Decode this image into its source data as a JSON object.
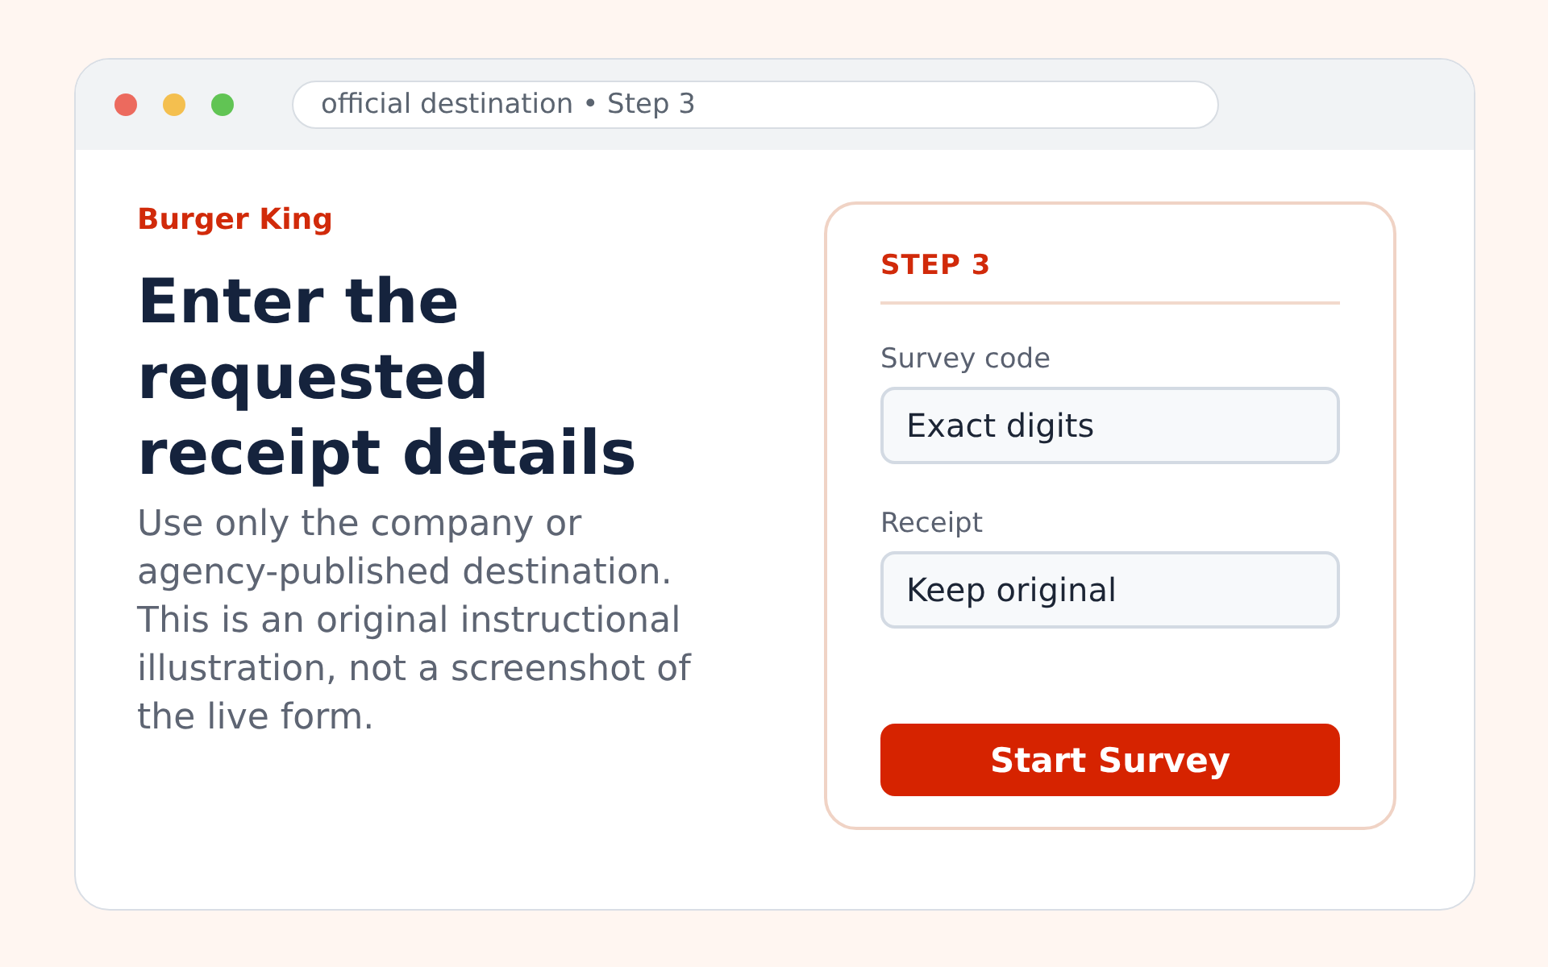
{
  "window": {
    "controls": [
      {
        "color": "#ec6a5e"
      },
      {
        "color": "#f4bf4f"
      },
      {
        "color": "#61c454"
      }
    ],
    "address": "official destination • Step 3"
  },
  "intro": {
    "brand": "Burger King",
    "heading": "Enter the requested receipt details",
    "description": "Use only the company or agency-published destination. This is an original instructional illustration, not a screenshot of the live form."
  },
  "card": {
    "step": "STEP 3",
    "fields": [
      {
        "label": "Survey code",
        "value": "Exact digits"
      },
      {
        "label": "Receipt",
        "value": "Keep original"
      }
    ],
    "button": "Start Survey"
  }
}
